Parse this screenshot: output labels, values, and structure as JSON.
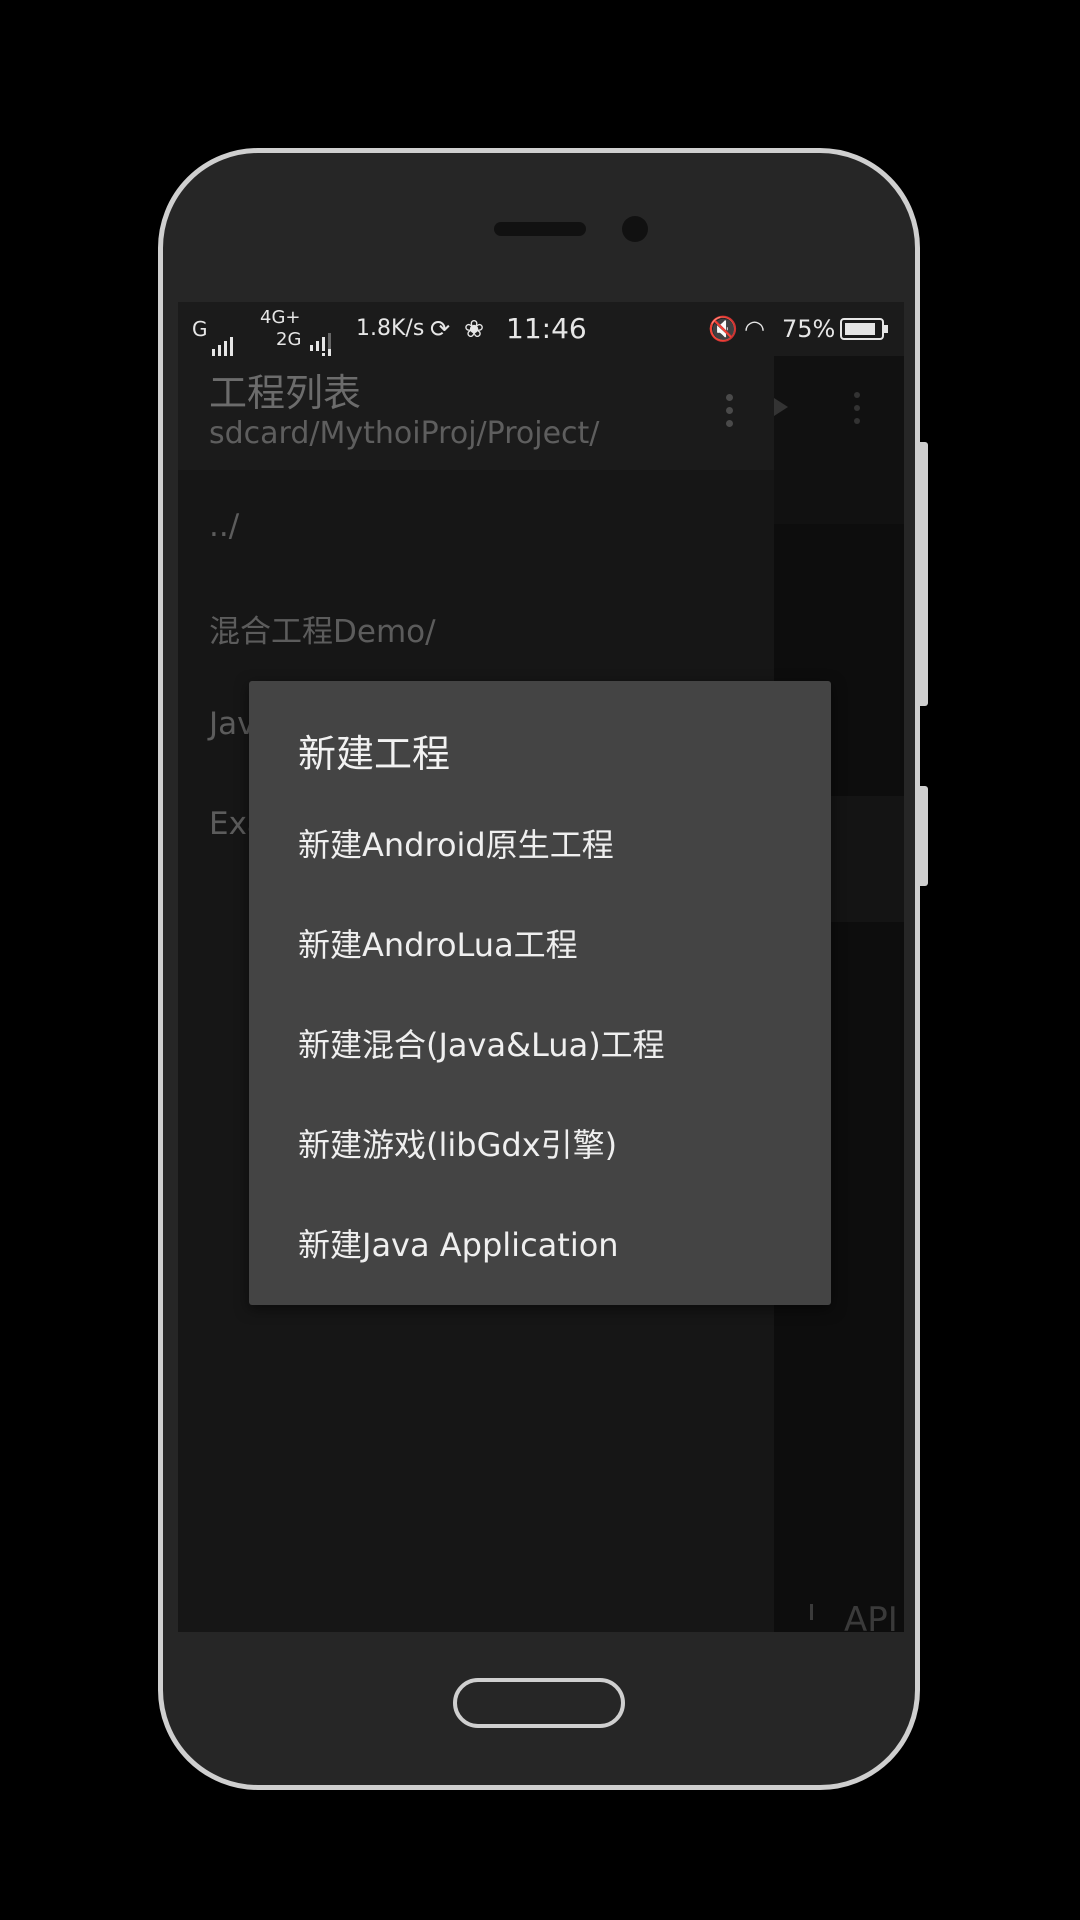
{
  "status_bar": {
    "carrier_g": "G",
    "net_4g": "4G+",
    "net_2g": "2G",
    "speed": "1.8K/s",
    "time": "11:46",
    "battery": "75%"
  },
  "project_list": {
    "title": "工程列表",
    "path": "sdcard/MythoiProj/Project/",
    "items": [
      "../",
      "混合工程Demo/",
      "Jav",
      "Exa"
    ]
  },
  "right_panel": {
    "api_label": "API"
  },
  "dialog": {
    "title": "新建工程",
    "options": [
      "新建Android原生工程",
      "新建AndroLua工程",
      "新建混合(Java&Lua)工程",
      "新建游戏(libGdx引擎)",
      "新建Java Application"
    ]
  },
  "colors": {
    "dialog_bg": "#444444",
    "screen_bg": "#161616",
    "phone_frame": "#cfcfcf"
  }
}
